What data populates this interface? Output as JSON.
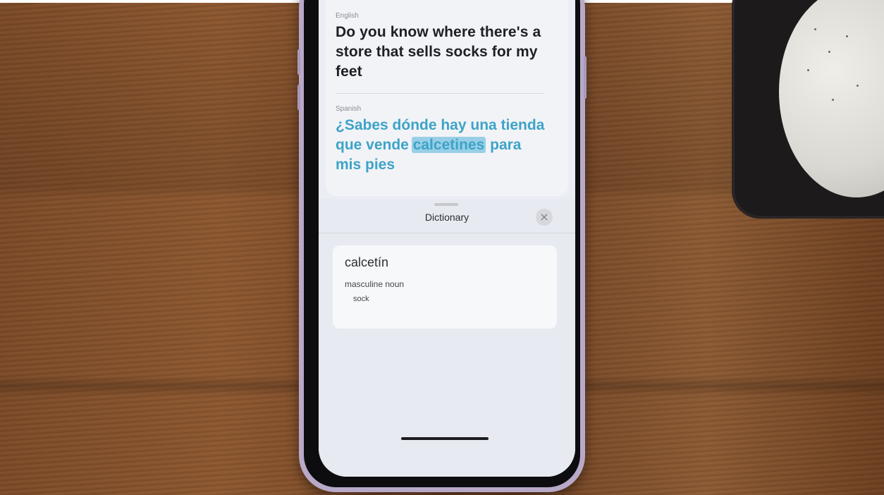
{
  "translate": {
    "source_language": "English",
    "source_text": "Do you know where there's a store that sells socks for my feet",
    "target_language": "Spanish",
    "target_prefix": "¿Sabes dónde hay una tienda que vende ",
    "target_highlight": "calcetines",
    "target_suffix": " para mis pies"
  },
  "dictionary": {
    "title": "Dictionary",
    "close_icon": "×",
    "headword": "calcetín",
    "part_of_speech": "masculine noun",
    "meaning": "sock"
  },
  "colors": {
    "accent": "#3da3c9",
    "highlight": "#98cfe6"
  }
}
